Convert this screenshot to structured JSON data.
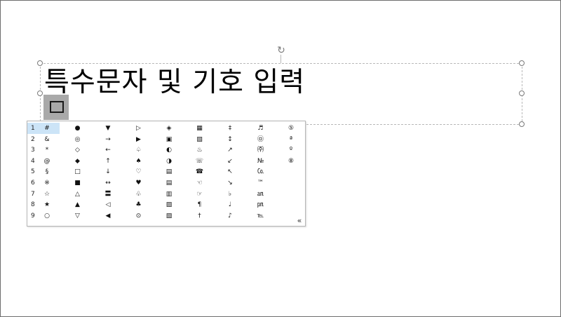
{
  "slide": {
    "title_text": "특수문자 및 기호 입력",
    "rotate_glyph": "↻",
    "ime_composing_glyph": ""
  },
  "symbol_picker": {
    "rows": [
      {
        "num": "1",
        "symbols": [
          "#",
          "●",
          "▼",
          "▷",
          "◈",
          "▦",
          "‡",
          "♬",
          "⑤"
        ]
      },
      {
        "num": "2",
        "symbols": [
          "&",
          "◎",
          "→",
          "▶",
          "▣",
          "▧",
          "↕",
          "㉤",
          "ª"
        ]
      },
      {
        "num": "3",
        "symbols": [
          "*",
          "◇",
          "←",
          "♤",
          "◐",
          "♨",
          "↗",
          "㈜",
          "º"
        ]
      },
      {
        "num": "4",
        "symbols": [
          "@",
          "◆",
          "↑",
          "♠",
          "◑",
          "☏",
          "↙",
          "№",
          "⑧"
        ]
      },
      {
        "num": "5",
        "symbols": [
          "§",
          "□",
          "↓",
          "♡",
          "▤",
          "☎",
          "↖",
          "㏇",
          ""
        ]
      },
      {
        "num": "6",
        "symbols": [
          "※",
          "■",
          "↔",
          "♥",
          "▤",
          "☜",
          "↘",
          "™",
          ""
        ]
      },
      {
        "num": "7",
        "symbols": [
          "☆",
          "△",
          "〓",
          "♧",
          "▥",
          "☞",
          "♭",
          "㏂",
          ""
        ]
      },
      {
        "num": "8",
        "symbols": [
          "★",
          "▲",
          "◁",
          "♣",
          "▨",
          "¶",
          "♩",
          "㏘",
          ""
        ]
      },
      {
        "num": "9",
        "symbols": [
          "○",
          "▽",
          "◀",
          "⊙",
          "▧",
          "†",
          "♪",
          "℡",
          ""
        ]
      }
    ],
    "expand_label": "«",
    "selected_row": "1"
  }
}
